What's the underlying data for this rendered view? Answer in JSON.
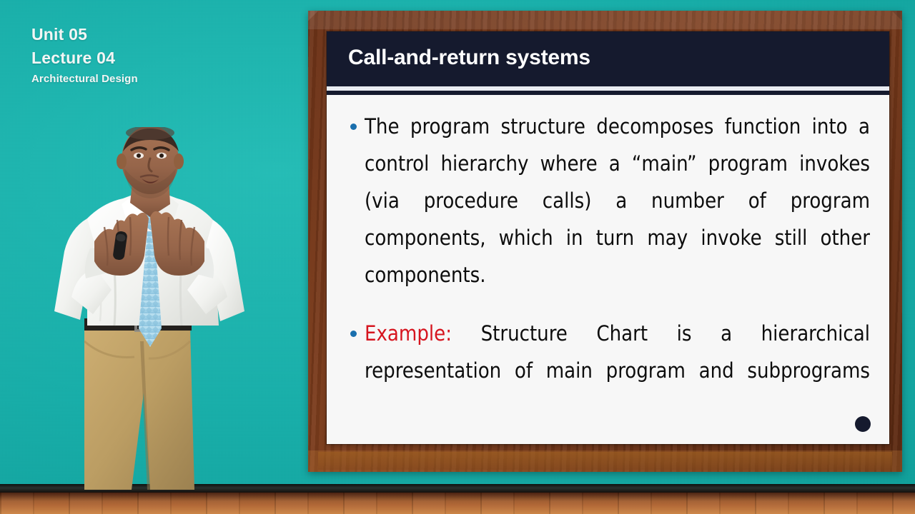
{
  "colors": {
    "wall_teal": "#17b2ac",
    "frame_wood": "#6d3318",
    "floor_wood": "#a9571f",
    "title_bar": "#151a2e",
    "slide_bg": "#f7f7f7",
    "bullet_blue": "#1a6fad",
    "emphasis_red": "#d6151f",
    "label_text": "#f2f6f5"
  },
  "overlay": {
    "unit": "Unit 05",
    "lecture": "Lecture 04",
    "subtitle": "Architectural Design"
  },
  "slide": {
    "title": "Call-and-return systems",
    "bullets": [
      {
        "id": "bullet-program-structure",
        "lines": [
          "The program structure decomposes function into a",
          "control hierarchy where a “main” program invokes",
          "(via procedure calls) a number of program",
          "components, which in turn may invoke still other",
          "components."
        ],
        "emphasis": ""
      },
      {
        "id": "bullet-example",
        "lines": [
          "Structure Chart is a hierarchical",
          "representation of main program and subprograms"
        ],
        "emphasis": "Example:"
      }
    ],
    "page_marker": "●"
  },
  "presenter": {
    "description": "presenter-standing",
    "shirt_color": "#f4f5f3",
    "tie_color": "#a9d9ec",
    "trousers_color": "#c2a46a",
    "belt_color": "#23201d",
    "skin_color": "#9c6a4b",
    "mic_color": "#1c1c1c"
  }
}
